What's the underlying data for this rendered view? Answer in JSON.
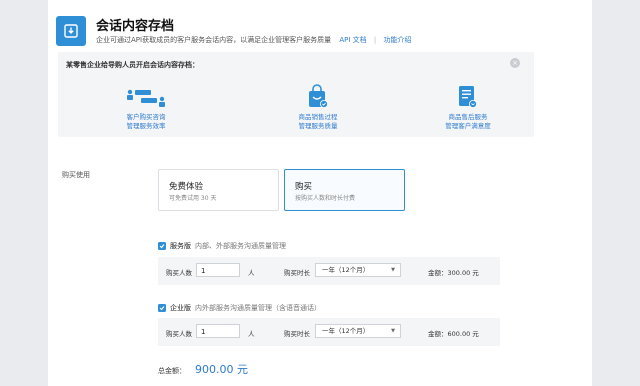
{
  "header": {
    "title": "会话内容存档",
    "subtitle": "企业可通过API获取成员的客户服务会话内容，以满足企业管理客户服务质量",
    "api_doc_link": "API 文档",
    "separator": "|",
    "feature_intro_link": "功能介绍",
    "icon": "download-box-icon"
  },
  "promo": {
    "title": "某零售企业给导购人员开启会话内容存档：",
    "close_icon": "close-icon",
    "features": [
      {
        "icon": "chat-people-icon",
        "line1": "客户购买咨询",
        "line2": "管理服务效率"
      },
      {
        "icon": "shopping-bag-icon",
        "line1": "商品销售过程",
        "line2": "管理服务质量"
      },
      {
        "icon": "document-check-icon",
        "line1": "商品售后服务",
        "line2": "管理客户满意度"
      }
    ]
  },
  "purchase": {
    "label": "购买使用",
    "options": [
      {
        "title": "免费体验",
        "subtitle": "可免费试用 30 天",
        "selected": false
      },
      {
        "title": "购买",
        "subtitle": "按购买人数和时长付费",
        "selected": true
      }
    ]
  },
  "packages": [
    {
      "name": "服务版",
      "desc": "内部、外部服务沟通质量管理",
      "checked": true,
      "count_label": "购买人数",
      "count_value": "1",
      "count_unit": "人",
      "duration_label": "购买时长",
      "duration_value": "一年（12个月）",
      "amount_label": "金额：",
      "amount_value": "300.00 元"
    },
    {
      "name": "企业版",
      "desc": "内外部服务沟通质量管理（含语音通话）",
      "checked": true,
      "count_label": "购买人数",
      "count_value": "1",
      "count_unit": "人",
      "duration_label": "购买时长",
      "duration_value": "一年（12个月）",
      "amount_label": "金额：",
      "amount_value": "600.00 元"
    }
  ],
  "total": {
    "label": "总金额：",
    "value": "900.00 元"
  },
  "colors": {
    "accent": "#2e8fd6",
    "link": "#2e7bcf",
    "background": "#e9ebee",
    "promo_bg": "#f4f5f7"
  }
}
